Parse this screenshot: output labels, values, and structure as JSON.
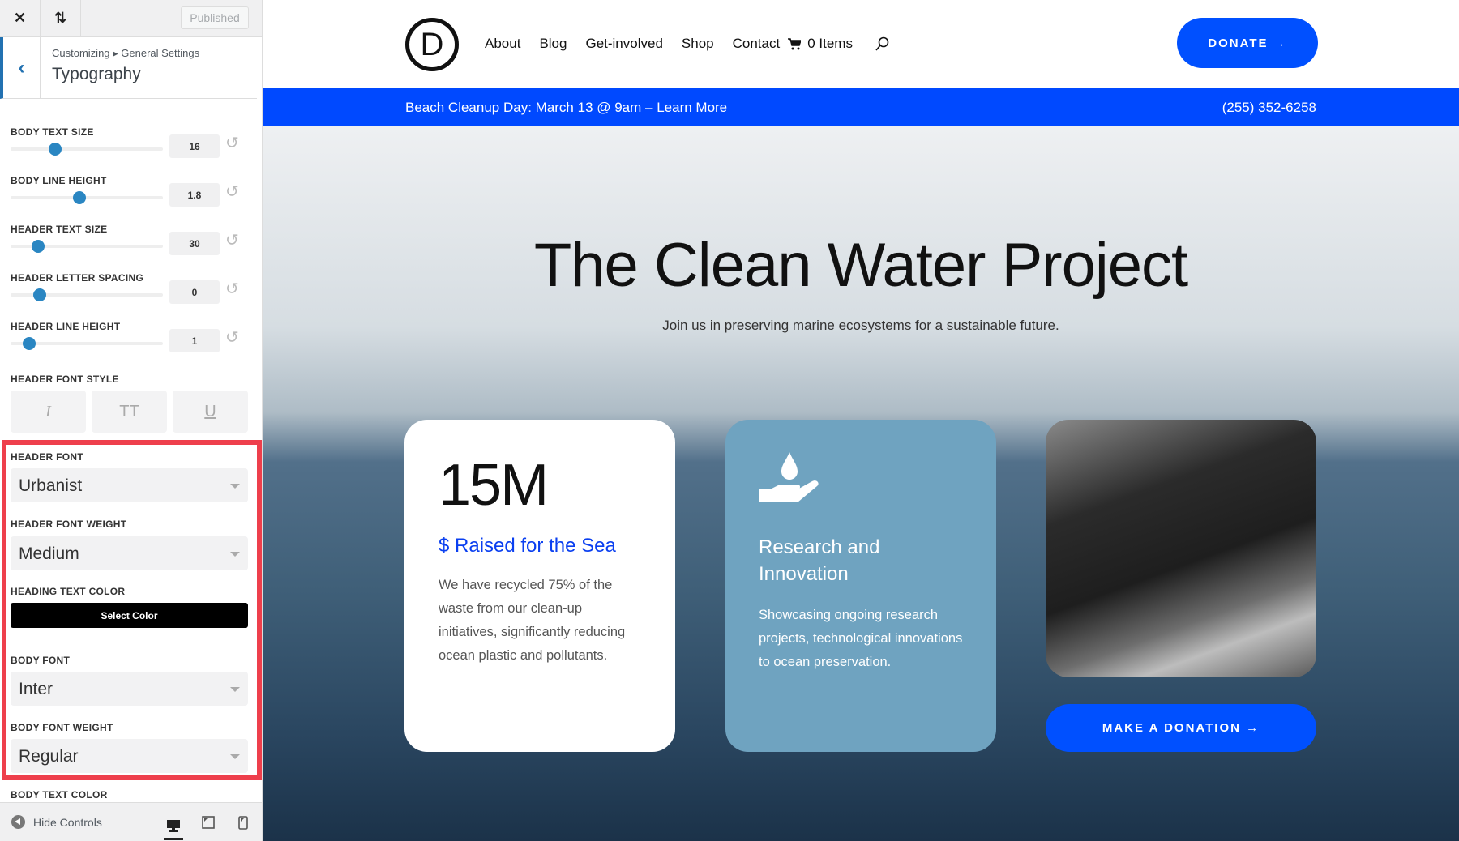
{
  "sidebar": {
    "close_icon": "close-icon",
    "reorder_icon": "arrows-up-down-icon",
    "published": "Published",
    "breadcrumb": {
      "root": "Customizing",
      "parent": "General Settings"
    },
    "title": "Typography",
    "sliders": [
      {
        "label": "BODY TEXT SIZE",
        "value": "16",
        "level": 0.29
      },
      {
        "label": "BODY LINE HEIGHT",
        "value": "1.8",
        "level": 0.45
      },
      {
        "label": "HEADER TEXT SIZE",
        "value": "30",
        "level": 0.18
      },
      {
        "label": "HEADER LETTER SPACING",
        "value": "0",
        "level": 0.19
      },
      {
        "label": "HEADER LINE HEIGHT",
        "value": "1",
        "level": 0.12
      }
    ],
    "font_style": {
      "label": "HEADER FONT STYLE",
      "buttons": [
        "I",
        "TT",
        "U"
      ]
    },
    "header_font": {
      "label": "HEADER FONT",
      "value": "Urbanist"
    },
    "header_font_weight": {
      "label": "HEADER FONT WEIGHT",
      "value": "Medium"
    },
    "heading_text_color": {
      "label": "HEADING TEXT COLOR",
      "button": "Select Color"
    },
    "body_font": {
      "label": "BODY FONT",
      "value": "Inter"
    },
    "body_font_weight": {
      "label": "BODY FONT WEIGHT",
      "value": "Regular"
    },
    "body_text_color": {
      "label": "BODY TEXT COLOR"
    },
    "hide_controls": "Hide Controls",
    "highlight_color": "#ee3f4c",
    "accent_color": "#2271b1"
  },
  "site": {
    "logo_letter": "D",
    "nav": [
      "About",
      "Blog",
      "Get-involved",
      "Shop",
      "Contact"
    ],
    "cart": "0 Items",
    "donate": "DONATE →",
    "announcement": {
      "text": "Beach Cleanup Day: March 13 @ 9am – ",
      "link": "Learn More",
      "phone": "(255) 352-6258"
    },
    "hero": {
      "title": "The Clean Water Project",
      "subtitle": "Join us in preserving marine ecosystems for a sustainable future."
    },
    "card1": {
      "big": "15M",
      "title": "$ Raised for the Sea",
      "body": "We have recycled 75% of the waste from our clean-up initiatives, significantly reducing ocean plastic and pollutants."
    },
    "card2": {
      "icon": "water-drop-hand-icon",
      "title": "Research and Innovation",
      "body": "Showcasing ongoing research projects, technological innovations to ocean preservation."
    },
    "cta": "MAKE A DONATION →",
    "brand_color": "#0049ff"
  }
}
